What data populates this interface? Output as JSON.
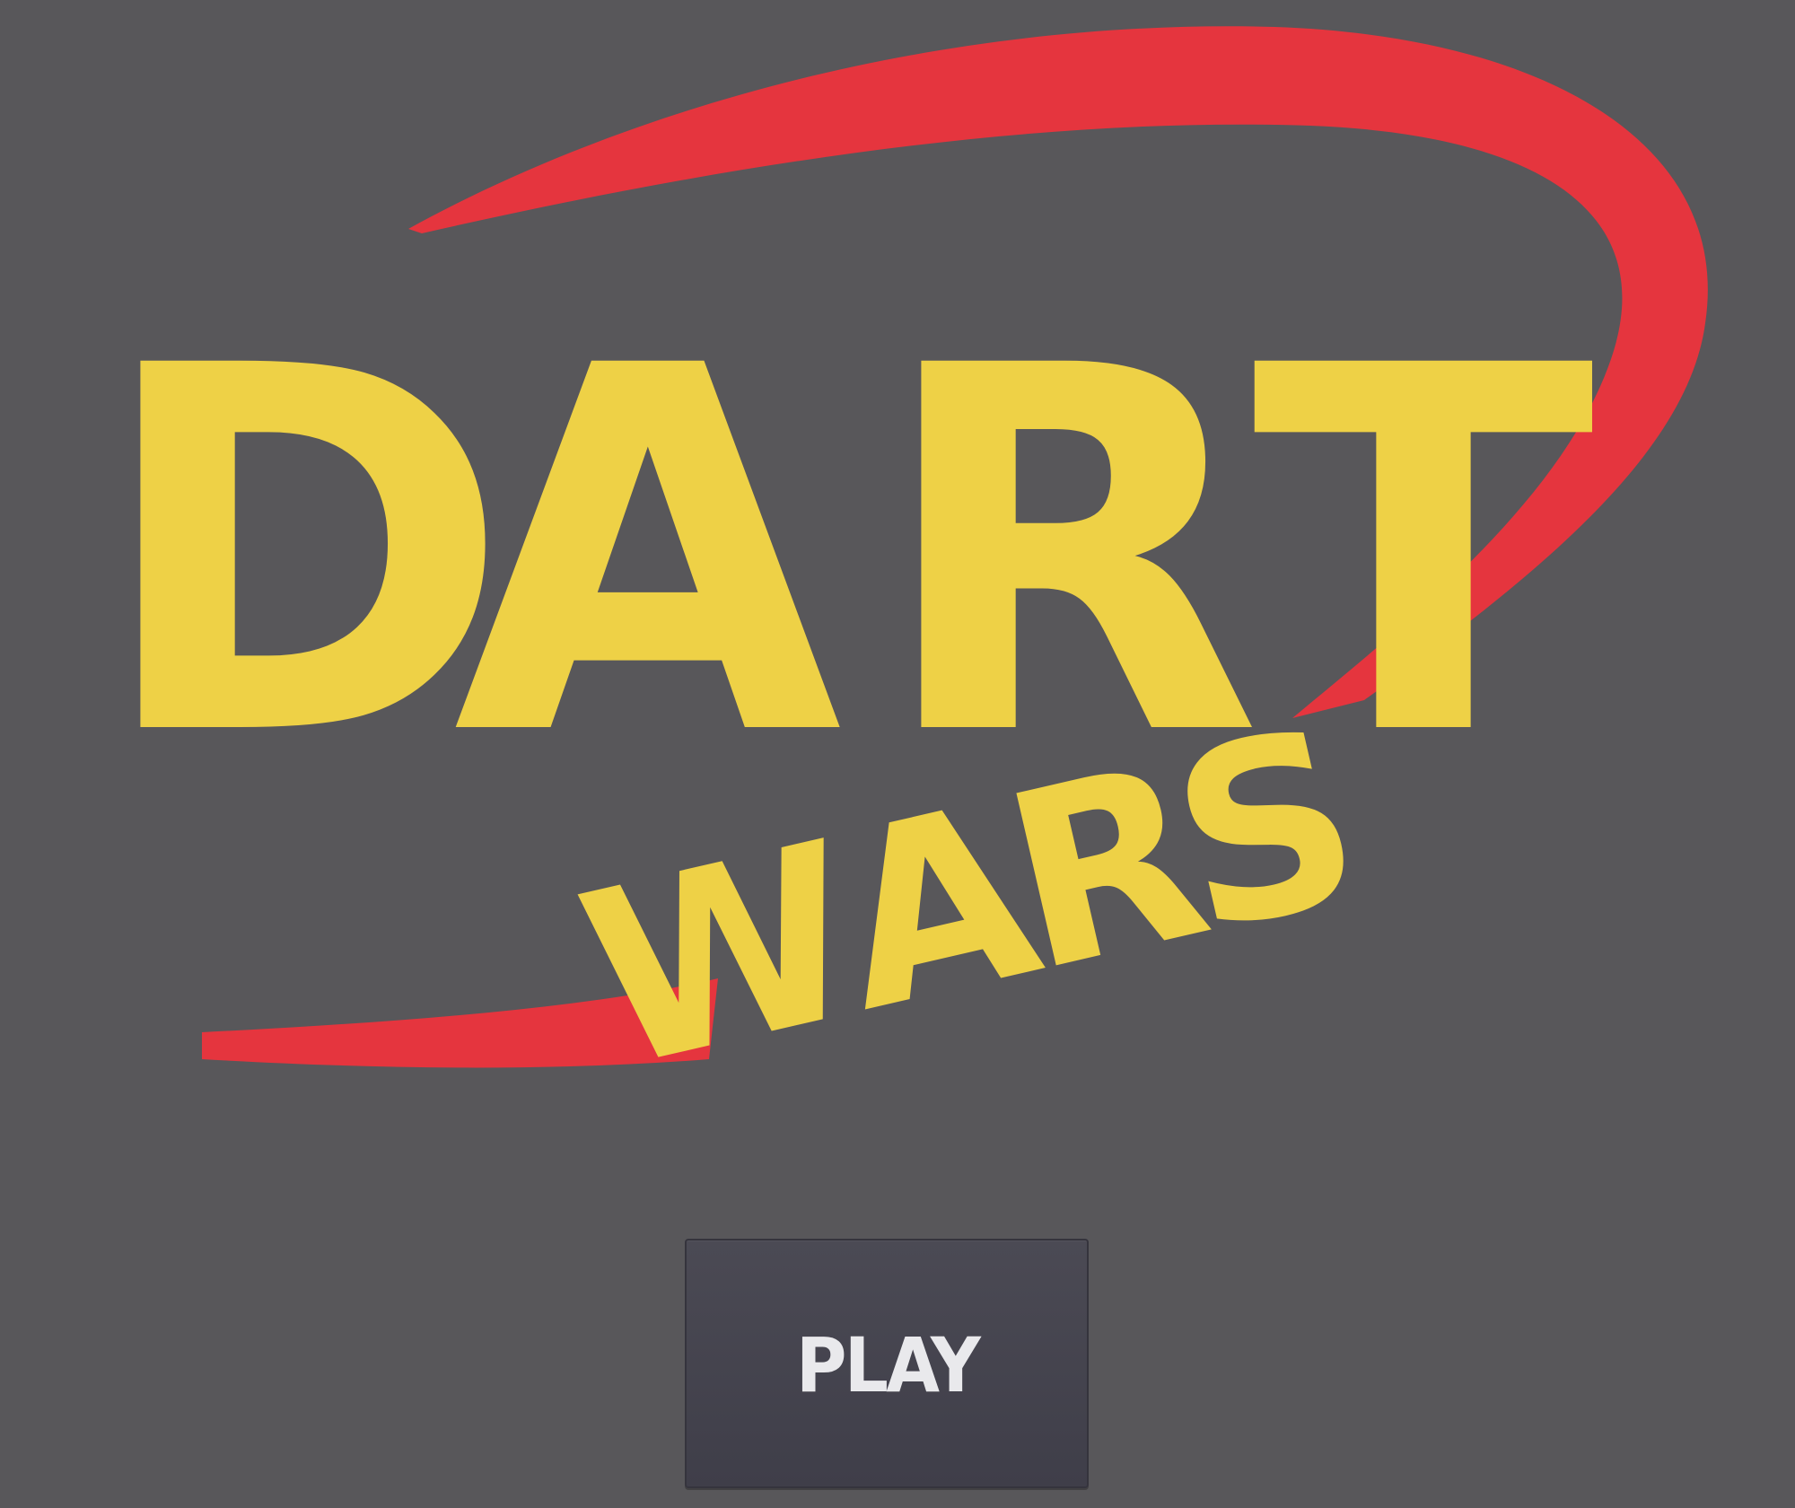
{
  "screen": {
    "name": "title-screen",
    "background_color": "#58575a"
  },
  "logo": {
    "word_main": "DART",
    "word_sub": "WARS",
    "letter_color": "#eed146",
    "swoosh_color": "#e5353e",
    "main_letters": [
      "D",
      "A",
      "R",
      "T"
    ],
    "sub_letters": [
      "W",
      "A",
      "R",
      "S"
    ]
  },
  "play_button": {
    "label": "PLAY",
    "background_color": "#45444e",
    "text_color": "#e9e9ec"
  }
}
